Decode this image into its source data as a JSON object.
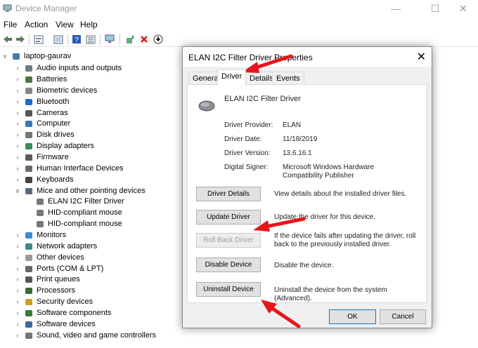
{
  "window": {
    "title": "Device Manager",
    "minimize": "—",
    "maximize": "☐",
    "close": "✕"
  },
  "menu": [
    "File",
    "Action",
    "View",
    "Help"
  ],
  "tree": {
    "root": "laptop-gaurav",
    "items": [
      "Audio inputs and outputs",
      "Batteries",
      "Biometric devices",
      "Bluetooth",
      "Cameras",
      "Computer",
      "Disk drives",
      "Display adapters",
      "Firmware",
      "Human Interface Devices",
      "Keyboards",
      "Mice and other pointing devices",
      "ELAN I2C Filter Driver",
      "HID-compliant mouse",
      "HID-compliant mouse",
      "Monitors",
      "Network adapters",
      "Other devices",
      "Ports (COM & LPT)",
      "Print queues",
      "Processors",
      "Security devices",
      "Software components",
      "Software devices",
      "Sound, video and game controllers"
    ]
  },
  "dialog": {
    "title": "ELAN I2C Filter Driver Properties",
    "close": "✕",
    "tabs": [
      "General",
      "Driver",
      "Details",
      "Events"
    ],
    "device_name": "ELAN I2C Filter Driver",
    "props": [
      {
        "label": "Driver Provider:",
        "value": "ELAN"
      },
      {
        "label": "Driver Date:",
        "value": "11/18/2019"
      },
      {
        "label": "Driver Version:",
        "value": "13.6.16.1"
      },
      {
        "label": "Digital Signer:",
        "value": "Microsoft Windows Hardware Compatibility Publisher"
      }
    ],
    "actions": [
      {
        "button": "Driver Details",
        "desc": "View details about the installed driver files."
      },
      {
        "button": "Update Driver",
        "desc": "Update the driver for this device."
      },
      {
        "button": "Roll Back Driver",
        "desc": "If the device fails after updating the driver, roll back to the previously installed driver."
      },
      {
        "button": "Disable Device",
        "desc": "Disable the device."
      },
      {
        "button": "Uninstall Device",
        "desc": "Uninstall the device from the system (Advanced)."
      }
    ],
    "ok": "OK",
    "cancel": "Cancel"
  },
  "colors": {
    "arrow": "#e8141b",
    "accent": "#0078d7"
  }
}
